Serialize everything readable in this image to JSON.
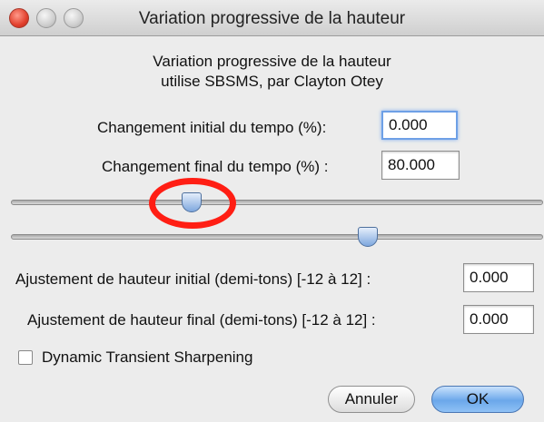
{
  "window": {
    "title": "Variation progressive de la hauteur"
  },
  "header": {
    "line1": "Variation progressive de la hauteur",
    "line2": "utilise SBSMS, par Clayton Otey"
  },
  "tempo": {
    "initial_label": "Changement initial du tempo  (%):",
    "initial_value": "0.000",
    "final_label": "Changement final du tempo  (%) :",
    "final_value": "80.000"
  },
  "sliders": {
    "initial_level_percent": 34,
    "final_level_percent": 67
  },
  "pitch": {
    "initial_label": "Ajustement de hauteur initial (demi-tons) [-12 à 12] :",
    "initial_value": "0.000",
    "final_label": "Ajustement de hauteur final (demi-tons) [-12 à 12] :",
    "final_value": "0.000"
  },
  "options": {
    "dynamic_label": "Dynamic Transient Sharpening",
    "dynamic_checked": false
  },
  "buttons": {
    "cancel_label": "Annuler",
    "ok_label": "OK"
  },
  "colors": {
    "highlight": "#ff1e14",
    "accent": "#6ba7ea"
  }
}
